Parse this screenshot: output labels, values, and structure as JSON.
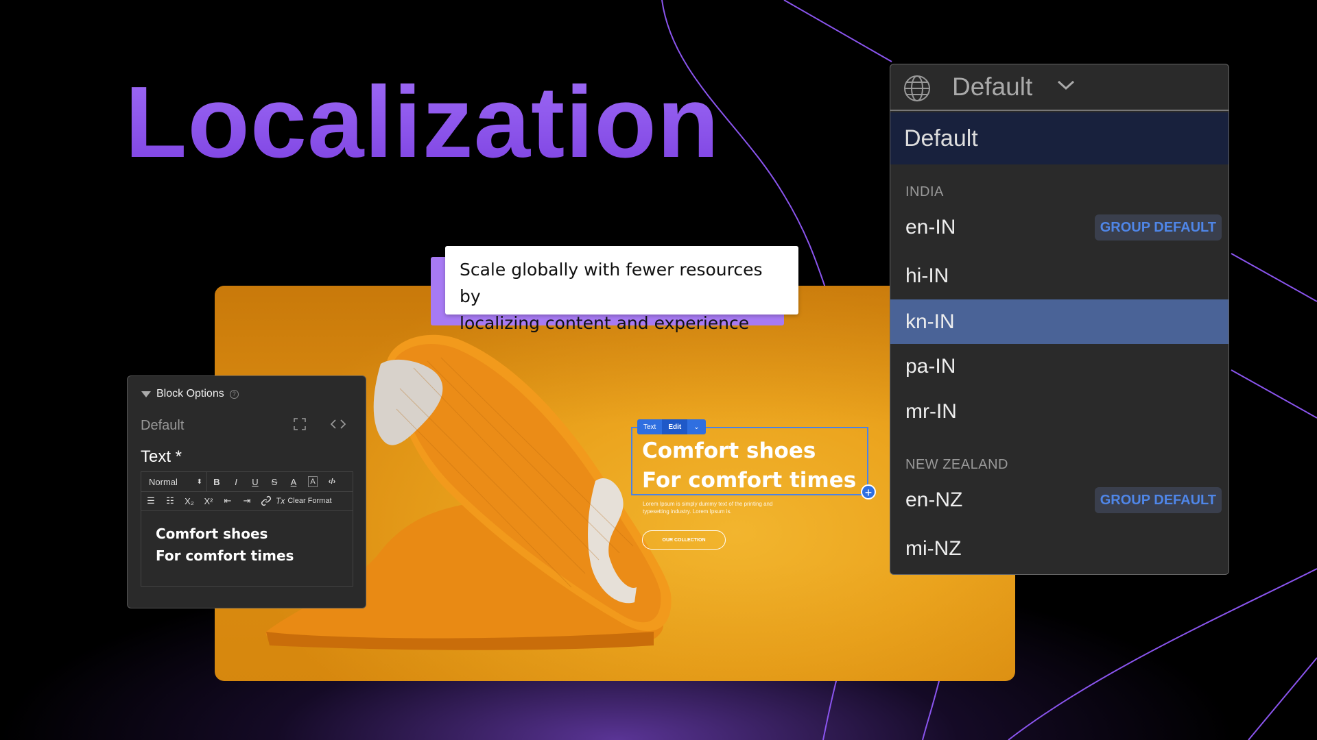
{
  "title": "Localization",
  "tagline": {
    "line1": "Scale globally with fewer resources by",
    "line2": "localizing content and experience"
  },
  "hero": {
    "heading_line1": "Comfort shoes",
    "heading_line2": "For comfort times",
    "body_line1": "Lorem Ipsum is simply dummy text of the printing and",
    "body_line2": "typesetting industry. Lorem Ipsum is.",
    "button_label": "OUR COLLECTION",
    "selection_toolbar": {
      "type_label": "Text",
      "edit_label": "Edit",
      "chevron": "⌄"
    },
    "add_button": "+"
  },
  "block_options": {
    "title": "Block Options",
    "help": "?",
    "locale_value": "Default",
    "field_label": "Text *",
    "toolbar": {
      "format_select": "Normal",
      "bold": "B",
      "italic": "I",
      "underline": "U",
      "strike": "S",
      "font_color": "A",
      "bg_color": "A",
      "code": "‹/›",
      "subscript": "X₂",
      "superscript": "X²",
      "clear_format_icon": "Tx",
      "clear_format": "Clear Format"
    },
    "content_line1": "Comfort shoes",
    "content_line2": "For comfort times"
  },
  "locale_dropdown": {
    "header_value": "Default",
    "selected": "Default",
    "groups": [
      {
        "name": "INDIA",
        "items": [
          {
            "label": "en-IN",
            "badge": "GROUP DEFAULT"
          },
          {
            "label": "hi-IN"
          },
          {
            "label": "kn-IN",
            "active": true
          },
          {
            "label": "pa-IN"
          },
          {
            "label": "mr-IN"
          }
        ]
      },
      {
        "name": "NEW ZEALAND",
        "items": [
          {
            "label": "en-NZ",
            "badge": "GROUP DEFAULT"
          },
          {
            "label": "mi-NZ"
          }
        ]
      }
    ]
  },
  "colors": {
    "title_gradient_top": "#a06ef7",
    "title_gradient_bottom": "#7b3fe0",
    "accent_purple": "#8e5cf0",
    "hero_orange": "#eba41e",
    "active_item": "#4a6397",
    "badge_text": "#4f86e8",
    "selection_blue": "#2f6fe0"
  },
  "icons": {
    "globe": "globe-icon",
    "chevron": "chevron-down-icon",
    "expand": "expand-icon",
    "code": "code-icon",
    "link": "link-icon"
  }
}
